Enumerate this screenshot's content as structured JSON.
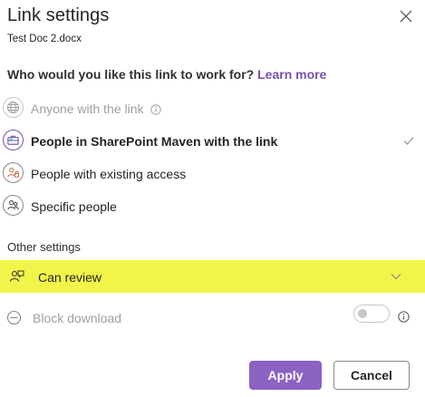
{
  "dialog": {
    "title": "Link settings",
    "file_name": "Test Doc 2.docx",
    "close_icon": "close-icon"
  },
  "scope": {
    "question": "Who would you like this link to work for?",
    "learn_more": "Learn more",
    "options": [
      {
        "label": "Anyone with the link",
        "icon": "globe-icon",
        "disabled": true,
        "selected": false
      },
      {
        "label": "People in SharePoint Maven with the link",
        "icon": "briefcase-icon",
        "disabled": false,
        "selected": true
      },
      {
        "label": "People with existing access",
        "icon": "people-lock-icon",
        "disabled": false,
        "selected": false
      },
      {
        "label": "Specific people",
        "icon": "people-icon",
        "disabled": false,
        "selected": false
      }
    ]
  },
  "other_settings": {
    "heading": "Other settings",
    "permission": {
      "label": "Can review",
      "icon": "review-icon",
      "highlight_color": "#f1f54a"
    },
    "block_download": {
      "label": "Block download",
      "enabled": false,
      "disabled": true
    }
  },
  "actions": {
    "apply": "Apply",
    "cancel": "Cancel",
    "accent_color": "#8c62c2"
  }
}
